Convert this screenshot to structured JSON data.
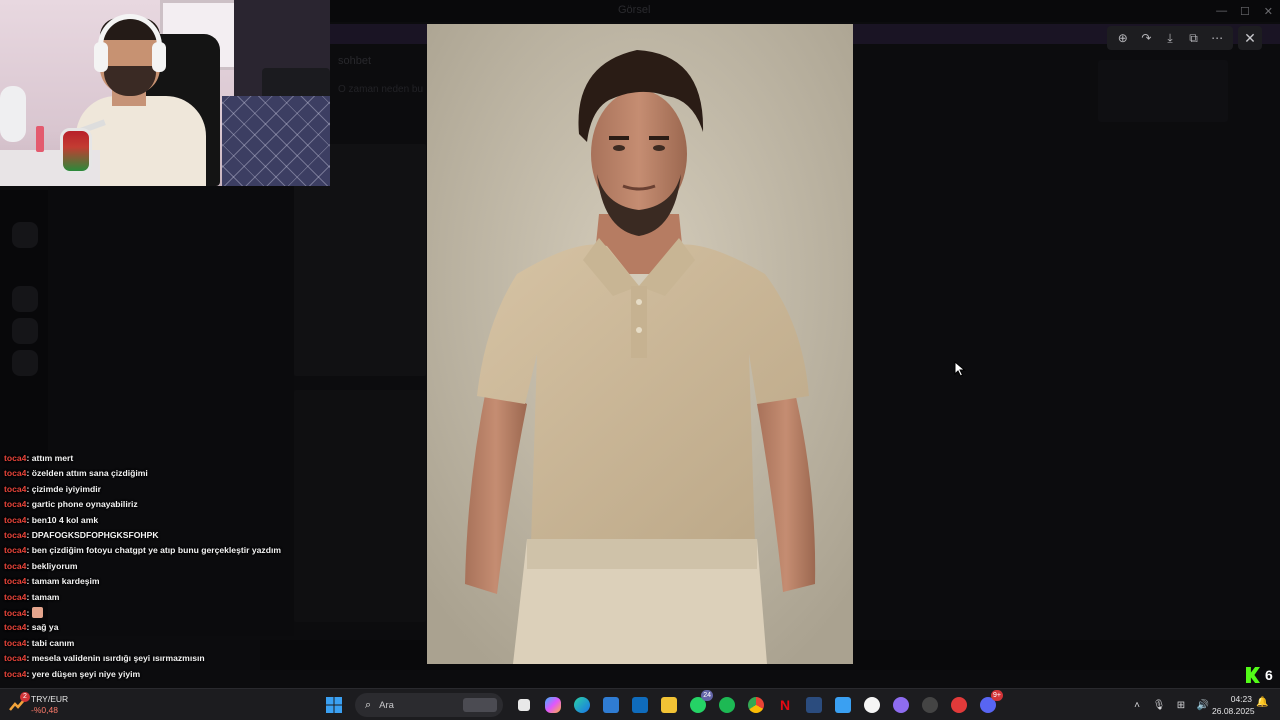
{
  "underlying_app": {
    "title": "Görsel",
    "channel_header": "sohbet",
    "channel_preview": "O zaman neden bu"
  },
  "viewer": {
    "toolbar": {
      "zoom_icon": "zoom-in-icon",
      "share_icon": "forward-icon",
      "download_icon": "download-icon",
      "open_icon": "open-external-icon",
      "more_icon": "more-icon"
    },
    "close_icon": "close-icon"
  },
  "chat": {
    "messages": [
      {
        "user": "toca4",
        "text": "attım mert"
      },
      {
        "user": "toca4",
        "text": "özelden attım sana çizdiğimi"
      },
      {
        "user": "toca4",
        "text": "çizimde iyiyimdir"
      },
      {
        "user": "toca4",
        "text": "gartic phone oynayabiliriz"
      },
      {
        "user": "toca4",
        "text": "ben10 4 kol amk"
      },
      {
        "user": "toca4",
        "text": "DPAFOGKSDFOPHGKSFOHPK"
      },
      {
        "user": "toca4",
        "text": "ben çizdiğim fotoyu chatgpt ye atıp bunu gerçekleştir yazdım"
      },
      {
        "user": "toca4",
        "text": "bekliyorum"
      },
      {
        "user": "toca4",
        "text": "tamam kardeşim"
      },
      {
        "user": "toca4",
        "text": "tamam"
      },
      {
        "user": "toca4",
        "text": "",
        "emoji": true
      },
      {
        "user": "toca4",
        "text": "sağ ya"
      },
      {
        "user": "toca4",
        "text": "tabi canım"
      },
      {
        "user": "toca4",
        "text": "mesela validenin ısırdığı şeyi ısırmazmısın"
      },
      {
        "user": "toca4",
        "text": "yere düşen şeyi niye yiyim"
      }
    ],
    "separator": ":"
  },
  "kick": {
    "count": "6"
  },
  "taskbar": {
    "weather": {
      "badge": "2",
      "line1": "TRY/EUR",
      "line2": "-%0,48"
    },
    "search": {
      "placeholder": "Ara"
    },
    "whatsapp_badge": "24",
    "discord_badge": "9+",
    "clock": {
      "time": "04:23",
      "date": "26.08.2025"
    }
  },
  "colors": {
    "username": "#e8443a",
    "kick_green": "#53fc18",
    "accent": "#6264a7"
  }
}
